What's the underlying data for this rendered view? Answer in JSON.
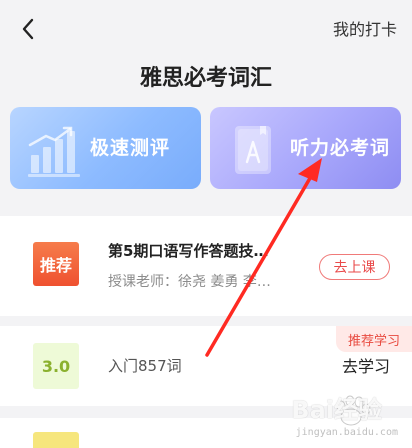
{
  "header": {
    "title": "雅思必考词汇",
    "checkin_label": "我的打卡",
    "back_icon": "chevron-left-icon"
  },
  "cards": [
    {
      "label": "极速测评",
      "icon": "bar-chart-up-icon",
      "accent": "#8dbbff"
    },
    {
      "label": "听力必考词",
      "icon": "book-icon",
      "accent": "#a8a7fb"
    }
  ],
  "course": {
    "badge": "推荐",
    "title": "第5期口语写作答题技…",
    "teacher": "授课老师：徐尧 姜勇 李…",
    "button": "去上课",
    "accent": "#ef5130"
  },
  "vocab": {
    "level": "3.0",
    "text": "入门857词",
    "tag": "推荐学习",
    "button": "去学习"
  },
  "watermark": {
    "brand": "Bai",
    "brand_suffix": "经验",
    "sub": "jingyan.baidu.com"
  }
}
